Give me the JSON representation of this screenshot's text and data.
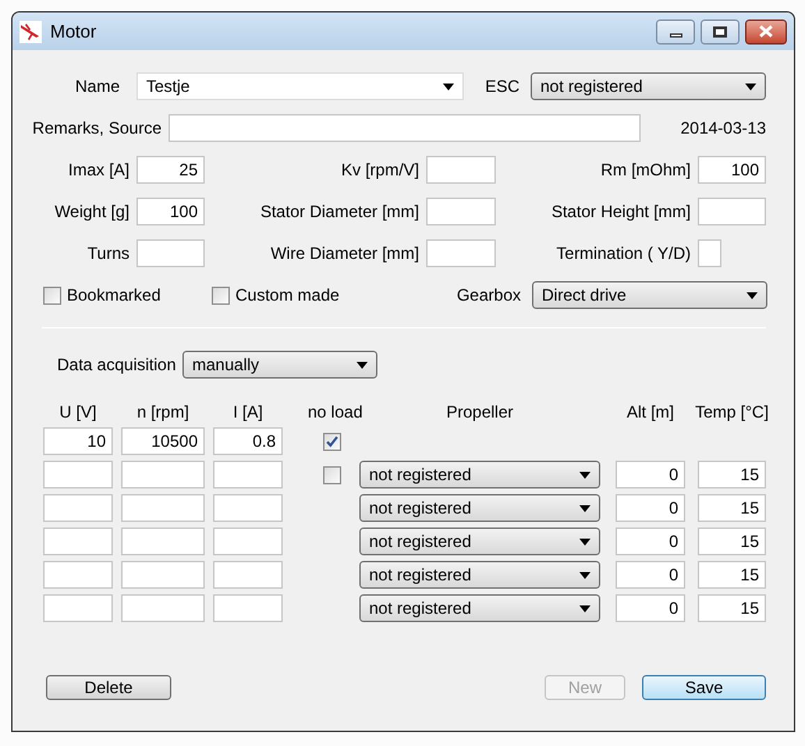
{
  "window": {
    "title": "Motor"
  },
  "name": {
    "label": "Name",
    "value": "Testje"
  },
  "esc": {
    "label": "ESC",
    "value": "not registered"
  },
  "remarks": {
    "label": "Remarks, Source"
  },
  "date": "2014-03-13",
  "fields": [
    {
      "label": "Imax [A]",
      "value": "25",
      "kind": "standard"
    },
    {
      "label": "Kv [rpm/V]",
      "kind": "standard"
    },
    {
      "label": "Rm [mOhm]",
      "value": "100",
      "kind": "standard"
    },
    {
      "label": "Weight [g]",
      "value": "100",
      "kind": "standard"
    },
    {
      "label": "Stator Diameter [mm]",
      "kind": "standard"
    },
    {
      "label": "Stator Height [mm]",
      "kind": "standard"
    },
    {
      "label": "Turns",
      "kind": "standard"
    },
    {
      "label": "Wire Diameter [mm]",
      "kind": "standard"
    },
    {
      "label": "Termination ( Y/D)",
      "kind": "narrow"
    }
  ],
  "checkboxes": [
    {
      "label": "Bookmarked",
      "checked": false
    },
    {
      "label": "Custom made",
      "checked": false
    }
  ],
  "gearbox": {
    "label": "Gearbox",
    "value": "Direct drive"
  },
  "data_acquisition": {
    "label": "Data acquisition",
    "value": "manually"
  },
  "table": {
    "columns": [
      "U [V]",
      "n [rpm]",
      "I [A]",
      "no load",
      "Propeller",
      "Alt [m]",
      "Temp [°C]"
    ],
    "rows": [
      {
        "u": "10",
        "n": "10500",
        "i": "0.8",
        "no_load": true
      },
      {
        "no_load": false,
        "propeller": "not registered",
        "alt": "0",
        "temp": "15"
      },
      {
        "propeller": "not registered",
        "alt": "0",
        "temp": "15"
      },
      {
        "propeller": "not registered",
        "alt": "0",
        "temp": "15"
      },
      {
        "propeller": "not registered",
        "alt": "0",
        "temp": "15"
      },
      {
        "propeller": "not registered",
        "alt": "0",
        "temp": "15"
      }
    ]
  },
  "buttons": [
    {
      "label": "Delete",
      "disabled": false,
      "default": false
    },
    {
      "label": "New",
      "disabled": true,
      "default": false
    },
    {
      "label": "Save",
      "disabled": false,
      "default": true
    }
  ]
}
